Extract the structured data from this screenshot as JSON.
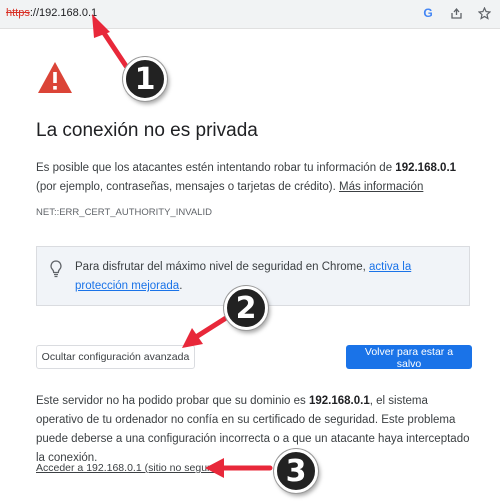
{
  "address_bar": {
    "scheme": "https",
    "rest": "://192.168.0.1",
    "icons": [
      "google-lens-icon",
      "share-icon",
      "star-icon"
    ],
    "google_glyph": "G"
  },
  "page": {
    "title": "La conexión no es privada",
    "desc_part1": "Es posible que los atacantes estén intentando robar tu información de ",
    "desc_host": "192.168.0.1",
    "desc_part2": " (por ejemplo, contraseñas, mensajes o tarjetas de crédito). ",
    "more_info": "Más información",
    "error_code": "NET::ERR_CERT_AUTHORITY_INVALID",
    "tip_text": "Para disfrutar del máximo nivel de seguridad en Chrome, ",
    "tip_link": "activa la protección mejorada",
    "tip_end": ".",
    "hide_advanced": "Ocultar configuración avanzada",
    "back_to_safety": "Volver para estar a salvo",
    "detail_part1": "Este servidor no ha podido probar que su dominio es ",
    "detail_host": "192.168.0.1",
    "detail_part2": ", el sistema operativo de tu ordenador no confía en su certificado de seguridad. Este problema puede deberse a una configuración incorrecta o a que un atacante haya interceptado la conexión.",
    "proceed_link": "Acceder a 192.168.0.1 (sitio no seguro)"
  },
  "annotations": {
    "badge_1": "1",
    "badge_2": "2",
    "badge_3": "3"
  },
  "colors": {
    "warning_red": "#db4437",
    "primary_blue": "#1a73e8",
    "annotation_arrow": "#e8283a"
  }
}
